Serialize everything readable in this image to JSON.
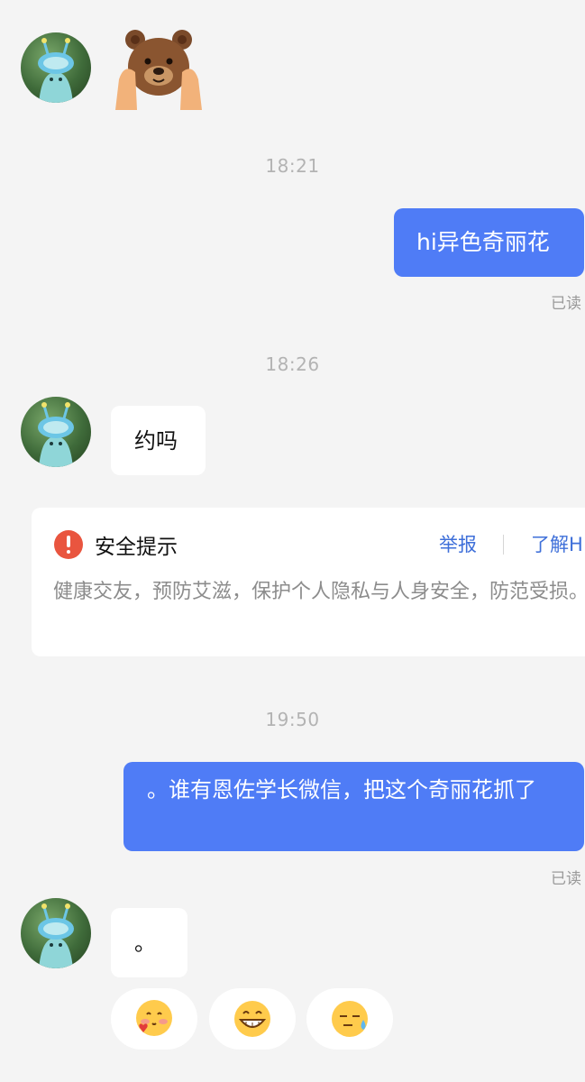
{
  "messages": [
    {
      "type": "sticker",
      "sender": "contact",
      "icon": "bear-sticker-icon"
    },
    {
      "type": "time",
      "text": "18:21"
    },
    {
      "type": "text",
      "sender": "me",
      "text": "hi异色奇丽花",
      "status": "已读"
    },
    {
      "type": "time",
      "text": "18:26"
    },
    {
      "type": "text",
      "sender": "contact",
      "text": "约吗"
    },
    {
      "type": "time",
      "text": "19:50"
    },
    {
      "type": "text",
      "sender": "me",
      "text": "。谁有恩佐学长微信，把这个奇丽花抓了",
      "status": "已读"
    },
    {
      "type": "text",
      "sender": "contact",
      "text": "。"
    }
  ],
  "safety_notice": {
    "title": "安全提示",
    "report_label": "举报",
    "learn_label": "了解H",
    "body": "健康交友，预防艾滋，保护个人隐私与人身安全，防范受损。",
    "accent_color": "#e9553f",
    "link_color": "#3e6fd9"
  },
  "quick_replies": [
    {
      "icon": "blushing-heart-face-icon"
    },
    {
      "icon": "grinning-face-icon"
    },
    {
      "icon": "sweat-face-icon"
    }
  ],
  "colors": {
    "outgoing_bubble": "#4f7cf6",
    "incoming_bubble": "#ffffff",
    "background": "#f4f4f4"
  }
}
